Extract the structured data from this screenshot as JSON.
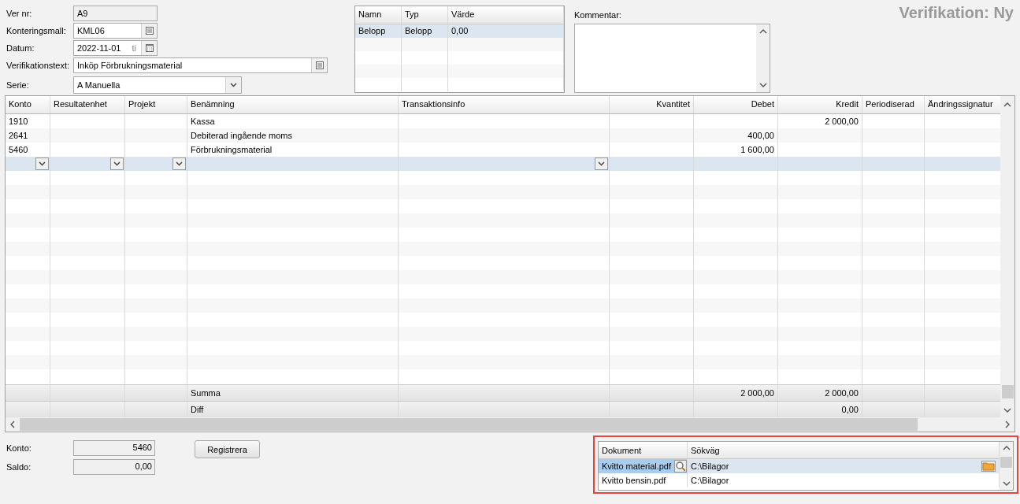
{
  "title": "Verifikation: Ny",
  "form": [
    {
      "label": "Ver nr:",
      "value": "A9",
      "kind": "readonly"
    },
    {
      "label": "Konteringsmall:",
      "value": "KML06",
      "kind": "lookup"
    },
    {
      "label": "Datum:",
      "value": "2022-11-01",
      "weekday": "ti",
      "kind": "date"
    },
    {
      "label": "Verifikationstext:",
      "value": "Inköp Förbrukningsmaterial",
      "kind": "lookup"
    },
    {
      "label": "Serie:",
      "value": "A  Manuella",
      "kind": "select"
    }
  ],
  "parameters": {
    "columns": [
      "Namn",
      "Typ",
      "Värde"
    ],
    "rows": [
      {
        "cells": [
          "Belopp",
          "Belopp",
          "0,00"
        ],
        "selected": true
      }
    ]
  },
  "comment": {
    "label": "Kommentar:"
  },
  "ledger": {
    "columns": [
      "Konto",
      "Resultatenhet",
      "Projekt",
      "Benämning",
      "Transaktionsinfo",
      "Kvantitet",
      "Debet",
      "Kredit",
      "Periodiserad",
      "Ändringssignatur"
    ],
    "rows": [
      {
        "selected": false,
        "cells": [
          "1910",
          null,
          null,
          "Kassa",
          null,
          null,
          null,
          "2 000,00",
          null,
          null
        ]
      },
      {
        "selected": false,
        "cells": [
          "2641",
          null,
          null,
          "Debiterad ingående moms",
          null,
          null,
          "400,00",
          null,
          null,
          null
        ]
      },
      {
        "selected": false,
        "cells": [
          "5460",
          null,
          null,
          "Förbrukningsmaterial",
          null,
          null,
          "1 600,00",
          null,
          null,
          null
        ]
      },
      {
        "selected": true,
        "cells": [
          {
            "kind": "dropdown"
          },
          {
            "kind": "dropdown"
          },
          {
            "kind": "dropdown"
          },
          null,
          {
            "kind": "dropdown"
          },
          null,
          null,
          null,
          null,
          null
        ]
      }
    ],
    "totals": [
      {
        "cells": [
          null,
          null,
          null,
          "Summa",
          null,
          null,
          "2 000,00",
          "2 000,00",
          null,
          null
        ]
      },
      {
        "cells": [
          null,
          null,
          null,
          "Diff",
          null,
          null,
          null,
          "0,00",
          null,
          null
        ]
      }
    ]
  },
  "summary": [
    {
      "label": "Konto:",
      "value": "5460"
    },
    {
      "label": "Saldo:",
      "value": "0,00"
    }
  ],
  "register_button": "Registrera",
  "documents": {
    "columns": [
      "Dokument",
      "Sökväg"
    ],
    "rows": [
      {
        "document": "Kvitto material.pdf",
        "path": "C:\\Bilagor",
        "selected": true
      },
      {
        "document": "Kvitto bensin.pdf",
        "path": "C:\\Bilagor",
        "selected": false
      }
    ]
  }
}
